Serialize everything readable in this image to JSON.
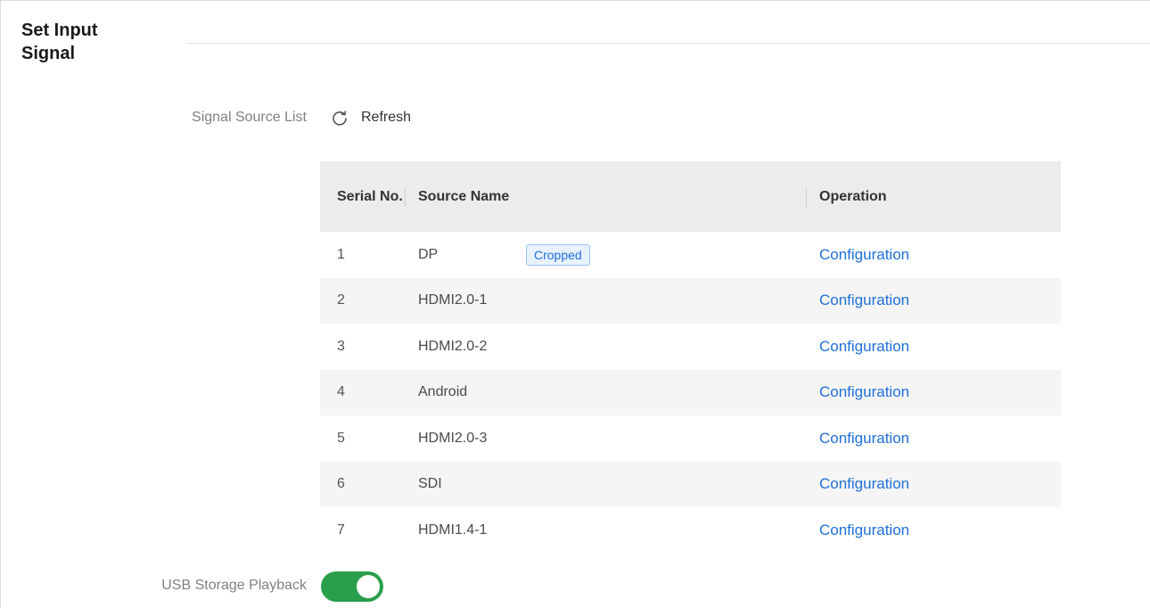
{
  "section": {
    "title": "Set Input Signal"
  },
  "signal_source": {
    "label": "Signal Source List",
    "refresh_label": "Refresh",
    "refresh_icon": "refresh-icon"
  },
  "table": {
    "headers": {
      "serial": "Serial No.",
      "name": "Source Name",
      "operation": "Operation"
    },
    "rows": [
      {
        "serial": "1",
        "name": "DP",
        "badge": "Cropped",
        "operation": "Configuration"
      },
      {
        "serial": "2",
        "name": "HDMI2.0-1",
        "badge": null,
        "operation": "Configuration"
      },
      {
        "serial": "3",
        "name": "HDMI2.0-2",
        "badge": null,
        "operation": "Configuration"
      },
      {
        "serial": "4",
        "name": "Android",
        "badge": null,
        "operation": "Configuration"
      },
      {
        "serial": "5",
        "name": "HDMI2.0-3",
        "badge": null,
        "operation": "Configuration"
      },
      {
        "serial": "6",
        "name": "SDI",
        "badge": null,
        "operation": "Configuration"
      },
      {
        "serial": "7",
        "name": "HDMI1.4-1",
        "badge": null,
        "operation": "Configuration"
      }
    ]
  },
  "usb_playback": {
    "label": "USB Storage Playback",
    "enabled": true
  },
  "colors": {
    "link": "#1e6fd9",
    "toggle_on": "#2a9f4b",
    "header_bg": "#ececec",
    "row_alt_bg": "#f5f5f5",
    "badge_text": "#1e6fd9",
    "badge_bg": "#e8f2ff"
  }
}
